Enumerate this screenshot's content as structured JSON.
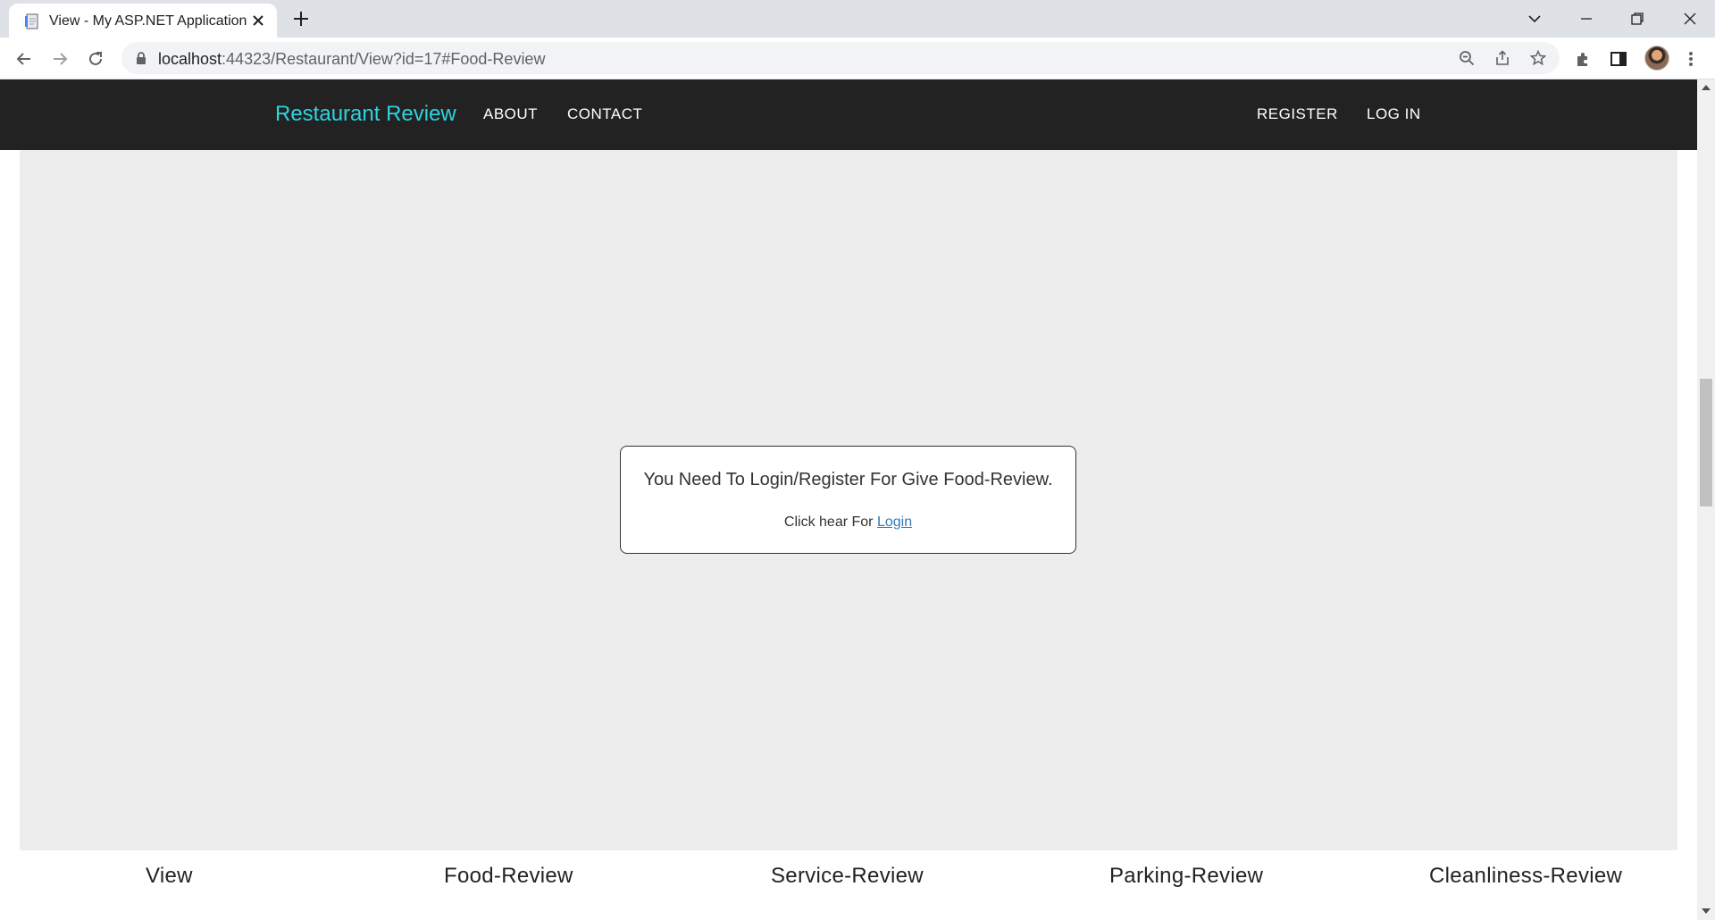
{
  "browser": {
    "tab_title": "View - My ASP.NET Application",
    "url_host": "localhost",
    "url_rest": ":44323/Restaurant/View?id=17#Food-Review"
  },
  "nav": {
    "brand": "Restaurant Review",
    "links": [
      "ABOUT",
      "CONTACT"
    ],
    "auth_links": [
      "REGISTER",
      "LOG IN"
    ]
  },
  "notice": {
    "message": "You Need To Login/Register For Give Food-Review.",
    "link_prefix": "Click hear For ",
    "link_label": "Login"
  },
  "bottom_tabs": [
    "View",
    "Food-Review",
    "Service-Review",
    "Parking-Review",
    "Cleanliness-Review"
  ],
  "colors": {
    "brand": "#2fd3e0",
    "navbar": "#222222",
    "link": "#337ab7"
  }
}
